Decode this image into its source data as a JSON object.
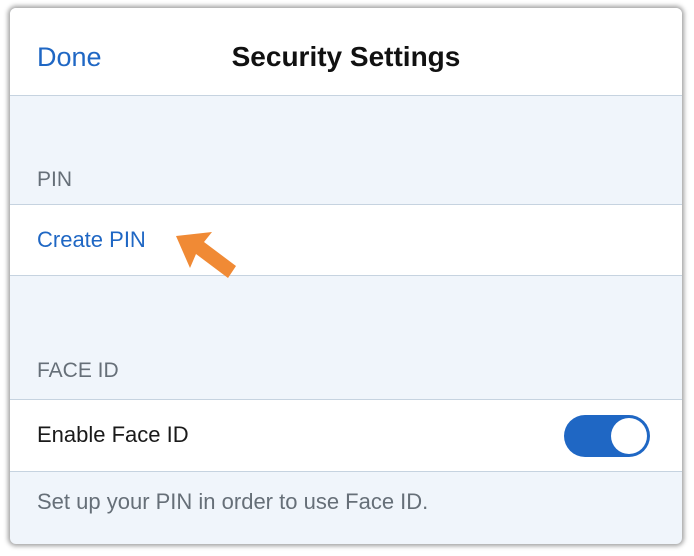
{
  "nav": {
    "done_label": "Done",
    "title": "Security Settings"
  },
  "sections": {
    "pin": {
      "header": "PIN",
      "create_pin_label": "Create PIN"
    },
    "face_id": {
      "header": "FACE ID",
      "enable_label": "Enable Face ID",
      "enabled": true,
      "footer": "Set up your PIN in order to use Face ID."
    }
  },
  "annotation": {
    "icon": "pointer-arrow-icon",
    "color": "#f08a35"
  },
  "colors": {
    "accent": "#1f67c4",
    "background": "#f0f5fb",
    "secondary_text": "#666f78"
  }
}
